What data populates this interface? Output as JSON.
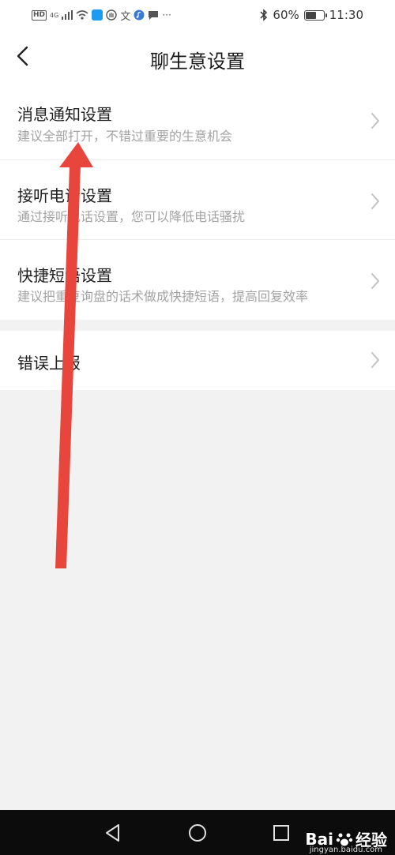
{
  "status": {
    "network": "4G",
    "battery_text": "60%",
    "battery_level": 0.6,
    "time": "11:30"
  },
  "header": {
    "title": "聊生意设置"
  },
  "settings": [
    {
      "title": "消息通知设置",
      "subtitle": "建议全部打开，不错过重要的生意机会"
    },
    {
      "title": "接听电话设置",
      "subtitle": "通过接听电话设置，您可以降低电话骚扰"
    },
    {
      "title": "快捷短语设置",
      "subtitle": "建议把重复询盘的话术做成快捷短语，提高回复效率"
    }
  ],
  "report": {
    "title": "错误上报"
  },
  "watermark": {
    "brand_left": "Bai",
    "brand_right": "经验",
    "domain": "jingyan.baidu.com"
  },
  "colors": {
    "background": "#f2f2f2",
    "card": "#ffffff",
    "arrow": "#e8453c",
    "nav_bar": "#0c0c0c"
  }
}
